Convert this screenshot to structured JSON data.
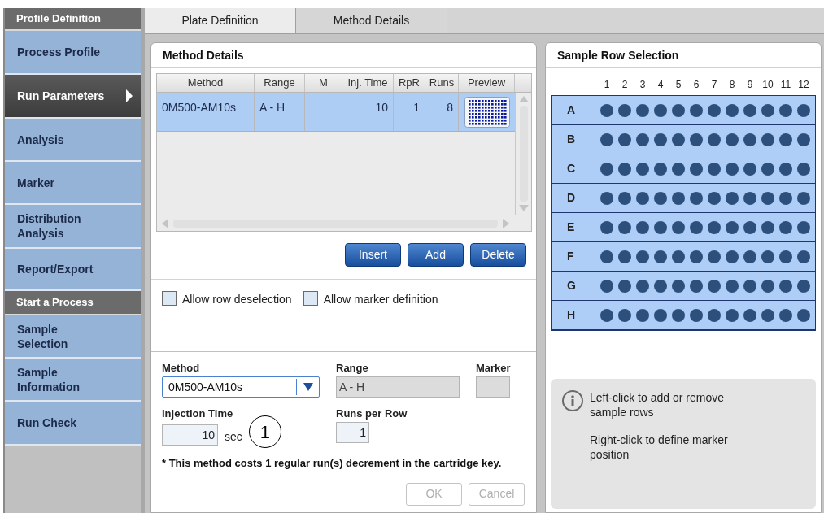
{
  "sidebar": {
    "sections": [
      {
        "header": "Profile Definition",
        "items": [
          {
            "label": "Process Profile",
            "selected": false
          },
          {
            "label": "Run Parameters",
            "selected": true
          },
          {
            "label": "Analysis",
            "selected": false
          },
          {
            "label": "Marker",
            "selected": false
          },
          {
            "label": "Distribution Analysis",
            "selected": false
          },
          {
            "label": "Report/Export",
            "selected": false
          }
        ]
      },
      {
        "header": "Start a Process",
        "items": [
          {
            "label": "Sample Selection",
            "selected": false
          },
          {
            "label": "Sample Information",
            "selected": false
          },
          {
            "label": "Run Check",
            "selected": false
          }
        ]
      }
    ]
  },
  "tabs": [
    {
      "label": "Plate Definition",
      "selected": true
    },
    {
      "label": "Method Details",
      "selected": false
    }
  ],
  "method_details": {
    "title": "Method Details",
    "table": {
      "columns": [
        "Method",
        "Range",
        "M",
        "Inj. Time",
        "RpR",
        "Runs",
        "Preview"
      ],
      "rows": [
        {
          "cells": [
            "0M500-AM10s",
            "A - H",
            "",
            "10",
            "1",
            "8"
          ],
          "selected": true
        }
      ]
    },
    "buttons": [
      "Insert",
      "Add",
      "Delete"
    ],
    "checkboxes": [
      {
        "label": "Allow row deselection",
        "checked": false
      },
      {
        "label": "Allow marker definition",
        "checked": false
      }
    ],
    "form": {
      "method": {
        "label": "Method",
        "value": "0M500-AM10s"
      },
      "range": {
        "label": "Range",
        "value": "A - H"
      },
      "marker": {
        "label": "Marker"
      },
      "injection_time": {
        "label": "Injection Time",
        "value": "10",
        "unit": "sec"
      },
      "callout": "1",
      "runs_per_row": {
        "label": "Runs per Row",
        "value": "1"
      }
    },
    "note": "* This method costs 1 regular run(s) decrement in the cartridge key.",
    "actions": [
      {
        "label": "OK",
        "disabled": true
      },
      {
        "label": "Cancel",
        "disabled": true
      }
    ]
  },
  "sample_row_selection": {
    "title": "Sample Row Selection",
    "columns": [
      "1",
      "2",
      "3",
      "4",
      "5",
      "6",
      "7",
      "8",
      "9",
      "10",
      "11",
      "12"
    ],
    "rows": [
      {
        "label": "A",
        "selected": true
      },
      {
        "label": "B",
        "selected": true
      },
      {
        "label": "C",
        "selected": true
      },
      {
        "label": "D",
        "selected": true
      },
      {
        "label": "E",
        "selected": true
      },
      {
        "label": "F",
        "selected": true
      },
      {
        "label": "G",
        "selected": true
      },
      {
        "label": "H",
        "selected": true
      }
    ],
    "info": [
      "Left-click to add or remove sample rows",
      "Right-click to define marker position"
    ]
  }
}
